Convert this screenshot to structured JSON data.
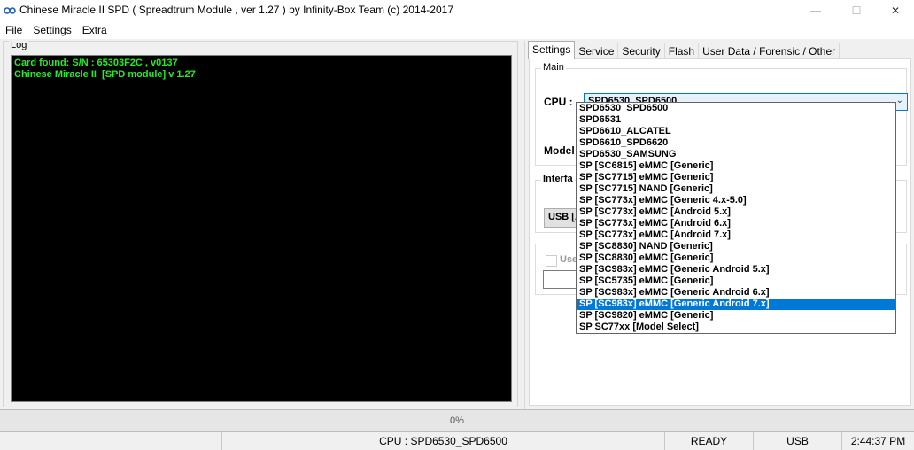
{
  "window": {
    "title": "Chinese Miracle II SPD ( Spreadtrum Module , ver 1.27 ) by Infinity-Box Team (c) 2014-2017",
    "min_glyph": "—",
    "max_glyph": "☐",
    "close_glyph": "✕"
  },
  "menu": {
    "items": [
      "File",
      "Settings",
      "Extra"
    ]
  },
  "log": {
    "legend": "Log",
    "lines": [
      "Card found: S/N : 65303F2C , v0137",
      "Chinese Miracle II  [SPD module] v 1.27"
    ]
  },
  "tabs": [
    "Settings",
    "Service",
    "Security",
    "Flash",
    "User Data / Forensic / Other"
  ],
  "settings": {
    "main_legend": "Main",
    "cpu_label": "CPU :",
    "cpu_value": "SPD6530_SPD6500",
    "model_label": "Model",
    "interface_legend": "Interfa",
    "interface_value": "USB [A",
    "use_label": "Use"
  },
  "dropdown": {
    "selected_index": 17,
    "options": [
      "SPD6530_SPD6500",
      "SPD6531",
      "SPD6610_ALCATEL",
      "SPD6610_SPD6620",
      "SPD6530_SAMSUNG",
      "SP [SC6815] eMMC [Generic]",
      "SP [SC7715] eMMC [Generic]",
      "SP [SC7715] NAND [Generic]",
      "SP [SC773x] eMMC [Generic 4.x-5.0]",
      "SP [SC773x] eMMC [Android 5.x]",
      "SP [SC773x] eMMC [Android 6.x]",
      "SP [SC773x] eMMC [Android 7.x]",
      "SP [SC8830] NAND [Generic]",
      "SP [SC8830] eMMC [Generic]",
      "SP [SC983x] eMMC [Generic Android 5.x]",
      "SP [SC5735] eMMC [Generic]",
      "SP [SC983x] eMMC [Generic Android 6.x]",
      "SP [SC983x] eMMC [Generic Android 7.x]",
      "SP [SC9820] eMMC [Generic]",
      "SP SC77xx [Model Select]"
    ]
  },
  "progress": {
    "text": "0%",
    "value": 0
  },
  "status": {
    "cpu": "CPU : SPD6530_SPD6500",
    "state": "READY",
    "interface": "USB",
    "time": "2:44:37 PM"
  }
}
